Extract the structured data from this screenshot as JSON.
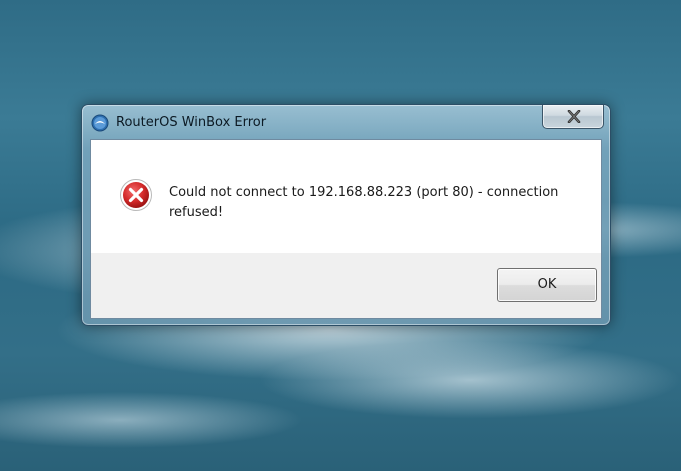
{
  "dialog": {
    "title": "RouterOS WinBox Error",
    "message": "Could not connect to 192.168.88.223 (port 80) - connection refused!",
    "ok_label": "OK",
    "close_label": "Close"
  },
  "icons": {
    "app": "winbox-app-icon",
    "close": "close-icon",
    "error": "error-icon"
  },
  "colors": {
    "error_red": "#d42a2a",
    "dialog_background": "#ffffff",
    "button_area": "#f0f0f0"
  }
}
